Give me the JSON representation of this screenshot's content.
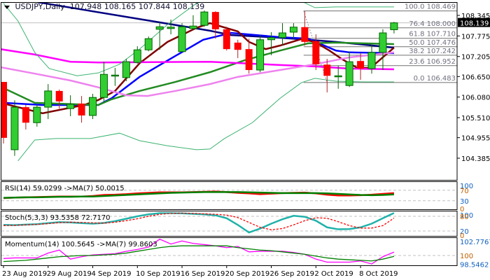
{
  "header": {
    "symbol": "USDJPY,Daily",
    "open": "107.948",
    "high": "108.165",
    "low": "107.844",
    "close": "108.139"
  },
  "colors": {
    "bull": "#32cd32",
    "bear": "#ff0000",
    "navy_ma": "#000080",
    "blue_ma": "#0000ff",
    "maroon_ma": "#800000",
    "green_ma": "#228b22",
    "magenta_ma": "#ff00ff",
    "violet_ma": "#ee82ee",
    "bands": "#3cb371",
    "fib": "#808080"
  },
  "chart_data": [
    {
      "type": "candlestick",
      "title": "USDJPY,Daily",
      "ylim": [
        104.385,
        108.345
      ],
      "y_ticks": [
        "108.345",
        "107.775",
        "107.205",
        "106.650",
        "106.080",
        "105.510",
        "104.955",
        "104.385"
      ],
      "current_price": "108.139",
      "x_labels": [
        {
          "i": 0,
          "label": "23 Aug 2019"
        },
        {
          "i": 4,
          "label": "29 Aug 2019"
        },
        {
          "i": 8,
          "label": "4 Sep 2019"
        },
        {
          "i": 12,
          "label": "10 Sep 2019"
        },
        {
          "i": 16,
          "label": "16 Sep 2019"
        },
        {
          "i": 20,
          "label": "20 Sep 2019"
        },
        {
          "i": 24,
          "label": "26 Sep 2019"
        },
        {
          "i": 28,
          "label": "2 Oct 2019"
        },
        {
          "i": 32,
          "label": "8 Oct 2019"
        }
      ],
      "ohlc": [
        [
          106.5,
          106.5,
          104.79,
          104.95
        ],
        [
          104.62,
          105.99,
          104.45,
          105.8
        ],
        [
          105.8,
          105.86,
          105.18,
          105.37
        ],
        [
          105.37,
          105.86,
          105.26,
          105.8
        ],
        [
          105.8,
          106.44,
          105.47,
          106.25
        ],
        [
          106.25,
          106.29,
          105.76,
          105.96
        ],
        [
          105.76,
          106.13,
          105.55,
          105.88
        ],
        [
          105.9,
          106.11,
          105.37,
          105.57
        ],
        [
          105.57,
          106.17,
          105.47,
          106.07
        ],
        [
          106.07,
          107.06,
          105.96,
          106.71
        ],
        [
          106.69,
          106.89,
          106.39,
          106.69
        ],
        [
          106.62,
          107.14,
          106.52,
          107.06
        ],
        [
          107.04,
          107.49,
          107.01,
          107.39
        ],
        [
          107.39,
          107.76,
          107.35,
          107.7
        ],
        [
          107.96,
          108.15,
          107.39,
          108.03
        ],
        [
          107.98,
          108.23,
          107.82,
          108.02
        ],
        [
          107.34,
          108.13,
          107.34,
          108.03
        ],
        [
          107.98,
          108.35,
          107.94,
          108.05
        ],
        [
          108.07,
          108.48,
          108.03,
          108.44
        ],
        [
          108.44,
          108.46,
          107.7,
          107.96
        ],
        [
          107.96,
          108.03,
          107.37,
          107.41
        ],
        [
          107.59,
          107.67,
          107.16,
          107.39
        ],
        [
          107.41,
          107.7,
          106.73,
          106.83
        ],
        [
          106.83,
          107.8,
          106.77,
          107.67
        ],
        [
          107.67,
          107.88,
          107.24,
          107.73
        ],
        [
          107.73,
          108.13,
          107.51,
          107.86
        ],
        [
          107.88,
          108.13,
          107.7,
          108.02
        ],
        [
          108.02,
          108.46,
          107.51,
          107.61
        ],
        [
          107.63,
          107.82,
          106.83,
          106.99
        ],
        [
          106.98,
          107.14,
          106.21,
          106.67
        ],
        [
          106.67,
          106.95,
          106.31,
          106.67
        ],
        [
          106.4,
          107.34,
          106.36,
          107.06
        ],
        [
          107.08,
          107.3,
          106.56,
          106.87
        ],
        [
          106.87,
          107.53,
          106.73,
          107.32
        ],
        [
          107.32,
          107.96,
          106.83,
          107.86
        ],
        [
          107.948,
          108.165,
          107.844,
          108.139
        ]
      ],
      "lines": [
        {
          "name": "navy-ma",
          "color": "#000080",
          "width": 2.5,
          "points": [
            [
              0,
              109.2
            ],
            [
              3.1,
              108.71
            ],
            [
              18.5,
              107.92
            ],
            [
              20.4,
              107.8
            ],
            [
              24,
              107.74
            ],
            [
              27.3,
              107.67
            ],
            [
              29.8,
              107.61
            ],
            [
              35,
              107.45
            ]
          ]
        },
        {
          "name": "blue-ma",
          "color": "#0000ff",
          "width": 2.5,
          "points": [
            [
              0,
              105.92
            ],
            [
              3.5,
              105.86
            ],
            [
              8.5,
              105.86
            ],
            [
              9.7,
              106.05
            ],
            [
              12.2,
              106.64
            ],
            [
              15.4,
              107.22
            ],
            [
              17.9,
              107.67
            ],
            [
              20.4,
              107.86
            ],
            [
              24.8,
              107.74
            ],
            [
              27.3,
              107.7
            ],
            [
              29.8,
              107.37
            ],
            [
              31,
              107.32
            ],
            [
              35,
              107.3
            ]
          ]
        },
        {
          "name": "maroon-ma",
          "color": "#800000",
          "width": 2.5,
          "points": [
            [
              0,
              105.9
            ],
            [
              3.5,
              105.63
            ],
            [
              7.2,
              105.86
            ],
            [
              8.5,
              106.0
            ],
            [
              10,
              106.25
            ],
            [
              12.2,
              107.02
            ],
            [
              14.7,
              107.61
            ],
            [
              17.3,
              108.0
            ],
            [
              18.5,
              108.13
            ],
            [
              21,
              107.9
            ],
            [
              22,
              107.61
            ],
            [
              23.5,
              107.41
            ],
            [
              24.8,
              107.51
            ],
            [
              26.7,
              107.69
            ],
            [
              27.9,
              107.61
            ],
            [
              29.2,
              107.37
            ],
            [
              30.4,
              107.12
            ],
            [
              31.7,
              106.89
            ],
            [
              32.9,
              106.89
            ],
            [
              35,
              107.45
            ]
          ]
        },
        {
          "name": "green-ma",
          "color": "#228b22",
          "width": 2.5,
          "points": [
            [
              0,
              106.33
            ],
            [
              2.8,
              105.92
            ],
            [
              8.5,
              105.86
            ],
            [
              9.7,
              106.02
            ],
            [
              12.2,
              106.25
            ],
            [
              15.4,
              106.5
            ],
            [
              18.5,
              106.77
            ],
            [
              21.6,
              107.1
            ],
            [
              24.8,
              107.37
            ],
            [
              27.3,
              107.57
            ],
            [
              29.8,
              107.59
            ],
            [
              35,
              107.55
            ]
          ]
        },
        {
          "name": "magenta-ma",
          "color": "#ff00ff",
          "width": 2.5,
          "points": [
            [
              -0.3,
              107.41
            ],
            [
              2.8,
              107.26
            ],
            [
              6,
              107.06
            ],
            [
              8.5,
              107.04
            ],
            [
              18.5,
              107.06
            ],
            [
              24.8,
              106.97
            ],
            [
              27.9,
              106.93
            ],
            [
              31,
              106.87
            ],
            [
              35,
              106.85
            ]
          ]
        },
        {
          "name": "violet-ma",
          "color": "#ee82ee",
          "width": 2.5,
          "points": [
            [
              -0.3,
              106.91
            ],
            [
              2.8,
              106.73
            ],
            [
              6,
              106.54
            ],
            [
              8.5,
              106.35
            ],
            [
              11,
              106.13
            ],
            [
              12.9,
              106.11
            ],
            [
              15.4,
              106.25
            ],
            [
              18.5,
              106.44
            ],
            [
              21,
              106.64
            ],
            [
              24.8,
              106.83
            ],
            [
              27.9,
              106.99
            ],
            [
              31,
              107.18
            ],
            [
              35,
              107.32
            ]
          ]
        },
        {
          "name": "bollinger-upper",
          "color": "#3cb371",
          "width": 1,
          "points": [
            [
              0,
              108.68
            ],
            [
              1.3,
              108.19
            ],
            [
              2.8,
              107.32
            ],
            [
              4.1,
              106.87
            ],
            [
              6.6,
              106.67
            ],
            [
              8.5,
              106.75
            ],
            [
              10.4,
              106.99
            ],
            [
              12.2,
              107.41
            ],
            [
              14.7,
              108.09
            ],
            [
              17.3,
              108.68
            ],
            [
              18.5,
              108.81
            ],
            [
              22.3,
              109.07
            ],
            [
              26.9,
              108.71
            ],
            [
              27.9,
              108.56
            ],
            [
              29.8,
              108.58
            ],
            [
              35,
              108.58
            ]
          ]
        },
        {
          "name": "bollinger-lower",
          "color": "#3cb371",
          "width": 1,
          "points": [
            [
              1.3,
              104.31
            ],
            [
              2.8,
              104.89
            ],
            [
              4.7,
              104.93
            ],
            [
              7.8,
              104.93
            ],
            [
              10.4,
              105.08
            ],
            [
              12.2,
              104.87
            ],
            [
              14.7,
              104.73
            ],
            [
              17.3,
              104.62
            ],
            [
              18.5,
              104.64
            ],
            [
              19.8,
              104.93
            ],
            [
              22.3,
              105.37
            ],
            [
              24.8,
              106.05
            ],
            [
              26.7,
              106.48
            ],
            [
              27.9,
              106.6
            ],
            [
              29.8,
              106.52
            ],
            [
              32.3,
              106.5
            ],
            [
              35,
              106.5
            ]
          ]
        }
      ],
      "fibonacci": {
        "from_i": 26.9,
        "levels": [
          {
            "label": "100.0 108.469",
            "value": 108.469
          },
          {
            "label": "76.4 108.000",
            "value": 108.0
          },
          {
            "label": "61.8 107.710",
            "value": 107.71
          },
          {
            "label": "50.0 107.476",
            "value": 107.476
          },
          {
            "label": "38.2 107.242",
            "value": 107.242
          },
          {
            "label": "23.6 106.952",
            "value": 106.952
          },
          {
            "label": "0.0 106.483",
            "value": 106.483
          }
        ]
      }
    },
    {
      "type": "line",
      "title": "RSI(14) 59.0299  ->MA(7) 50.0015",
      "ylim": [
        0,
        100
      ],
      "levels": [
        70,
        30
      ],
      "y_ticks": [
        "100",
        "70",
        "30",
        "0"
      ],
      "series": [
        {
          "name": "RSI(14)",
          "color": "#ff0000",
          "values": [
            40,
            42,
            43,
            44,
            45,
            46,
            46,
            46,
            48,
            52,
            53,
            55,
            58,
            60,
            62,
            62,
            62,
            63,
            64,
            65,
            63,
            60,
            58,
            55,
            57,
            59,
            60,
            61,
            58,
            53,
            50,
            50,
            51,
            53,
            56,
            59.03
          ]
        },
        {
          "name": "MA(7)",
          "color": "#008000",
          "values": [
            41,
            42,
            43,
            43,
            44,
            45,
            45,
            46,
            46,
            48,
            50,
            52,
            54,
            56,
            58,
            60,
            61,
            62,
            63,
            63,
            63,
            63,
            62,
            61,
            60,
            59,
            59,
            59,
            59,
            58,
            56,
            54,
            52,
            51,
            52,
            54
          ]
        }
      ]
    },
    {
      "type": "line",
      "title": "Stoch(5,3,3) 93.5358 72.7170",
      "ylim": [
        0,
        100
      ],
      "levels": [
        80,
        20
      ],
      "y_ticks": [
        "100",
        "80",
        "20",
        "0"
      ],
      "series": [
        {
          "name": "%K",
          "color": "#20b2aa",
          "values": [
            45,
            44,
            46,
            48,
            52,
            56,
            55,
            52,
            50,
            53,
            60,
            70,
            80,
            88,
            93,
            93,
            92,
            90,
            88,
            84,
            72,
            45,
            14,
            30,
            50,
            68,
            82,
            78,
            62,
            35,
            27,
            28,
            35,
            50,
            72,
            93.54
          ]
        },
        {
          "name": "%D",
          "color": "#ff0000",
          "dashed": true,
          "values": [
            42,
            43,
            45,
            47,
            50,
            54,
            56,
            55,
            53,
            52,
            56,
            62,
            70,
            80,
            88,
            92,
            93,
            92,
            90,
            88,
            85,
            75,
            55,
            35,
            25,
            30,
            45,
            62,
            74,
            72,
            58,
            42,
            32,
            32,
            42,
            72.72
          ]
        }
      ]
    },
    {
      "type": "line",
      "title": "Momentum(14) 100.5645  ->MA(7) 99.8603",
      "ylim": [
        98.5462,
        102.7767
      ],
      "levels": [
        100
      ],
      "y_ticks": [
        "102.7767",
        "100",
        "98.5462"
      ],
      "series": [
        {
          "name": "Momentum(14)",
          "color": "#ff00ff",
          "values": [
            99.5,
            99.6,
            99.6,
            99.6,
            100.4,
            100.9,
            99.4,
            99.8,
            100.1,
            100.2,
            100.3,
            100.7,
            101.0,
            101.4,
            102.7,
            101.9,
            102.4,
            102.0,
            101.8,
            101.6,
            101.3,
            101.5,
            100.6,
            100.7,
            100.7,
            100.7,
            100.5,
            100.2,
            99.4,
            98.9,
            98.9,
            98.9,
            99.1,
            98.6,
            99.8,
            100.56
          ]
        },
        {
          "name": "MA(7)",
          "color": "#008000",
          "values": [
            99.0,
            99.1,
            99.2,
            99.4,
            99.6,
            99.8,
            99.9,
            100.0,
            100.0,
            100.1,
            100.2,
            100.4,
            100.7,
            101.0,
            101.3,
            101.5,
            101.6,
            101.6,
            101.6,
            101.6,
            101.6,
            101.3,
            101.1,
            100.9,
            100.8,
            100.6,
            100.4,
            100.2,
            99.9,
            99.6,
            99.4,
            99.3,
            99.2,
            99.1,
            99.4,
            99.86
          ]
        }
      ]
    }
  ]
}
